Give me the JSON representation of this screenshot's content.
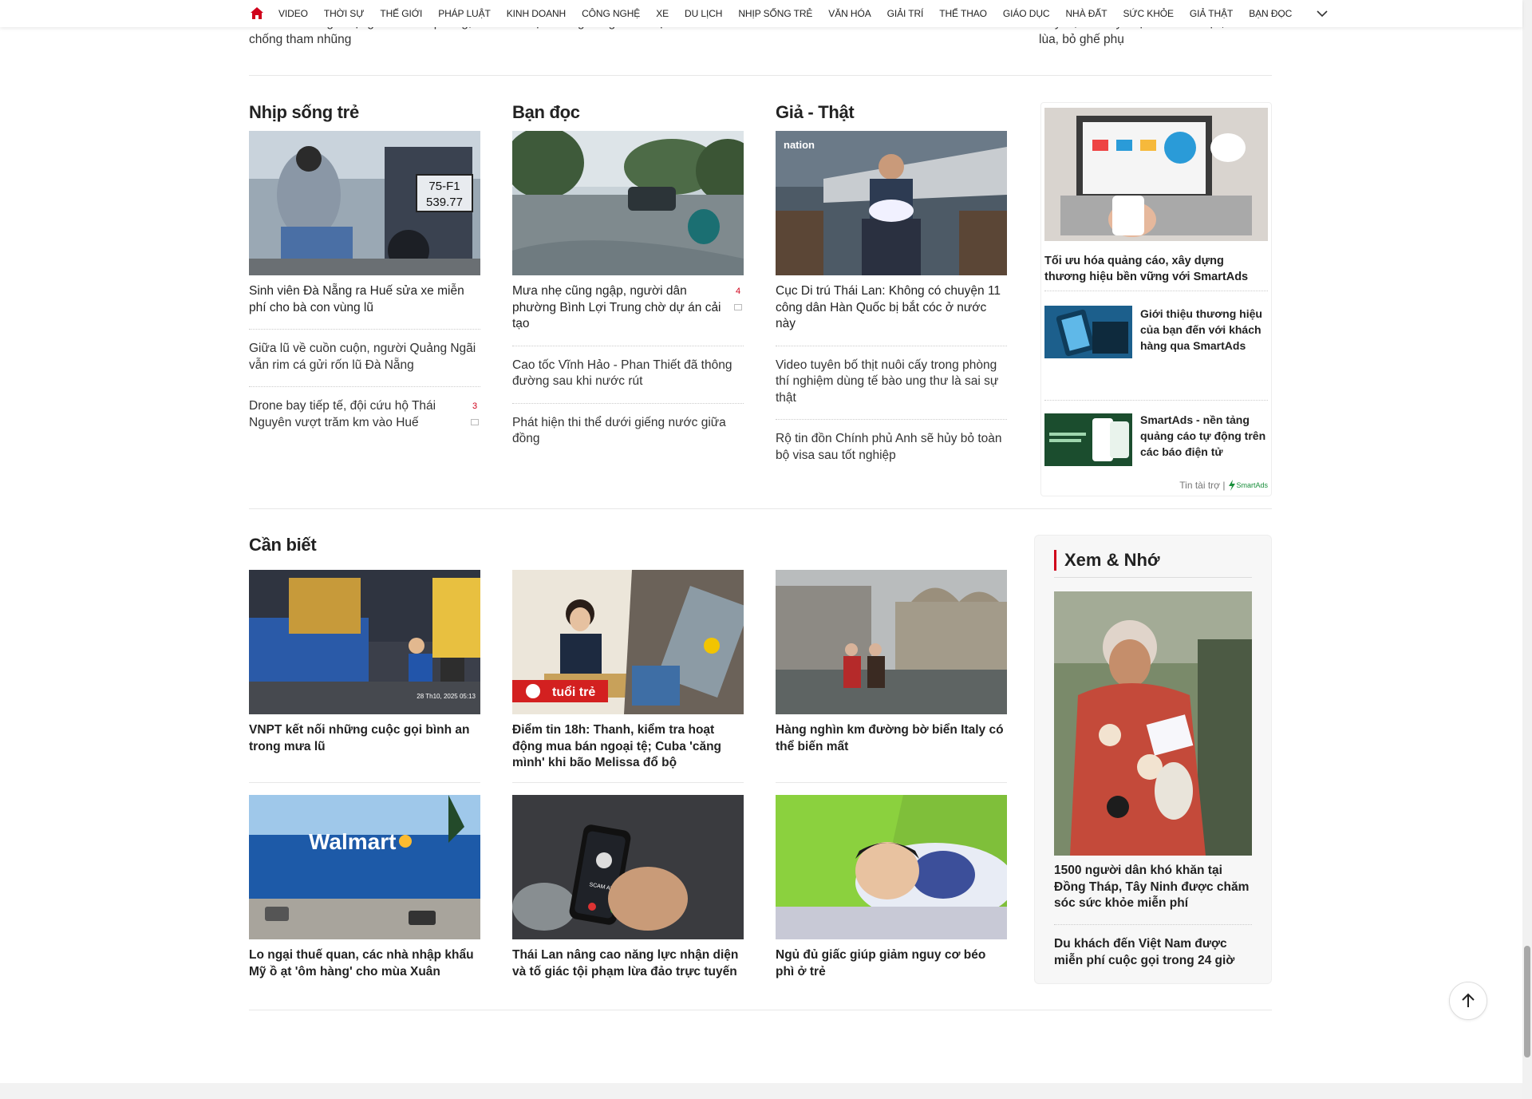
{
  "nav": {
    "items": [
      "VIDEO",
      "THỜI SỰ",
      "THẾ GIỚI",
      "PHÁP LUẬT",
      "KINH DOANH",
      "CÔNG NGHỆ",
      "XE",
      "DU LỊCH",
      "NHỊP SỐNG TRẺ",
      "VĂN HÓA",
      "GIẢI TRÍ",
      "THỂ THAO",
      "GIÁO DỤC",
      "NHÀ ĐẤT",
      "SỨC KHỎE",
      "GIẢ THẬT",
      "BẠN ĐỌC"
    ]
  },
  "prev": {
    "col1": "X cho các tác giả đạt giải báo chí phòng, chống tham nhũng",
    "col2": "ổn định trong thế giới bất định",
    "col4": "Royce, Bentley: Nội thất siêu độc, sức lùa, bỏ ghế phụ"
  },
  "sections": {
    "nhip_song_tre": {
      "title": "Nhịp sống trẻ",
      "lead": "Sinh viên Đà Nẵng ra Huế sửa xe miễn phí cho bà con vùng lũ",
      "plate_line1": "75-F1",
      "plate_line2": "539.77",
      "items": [
        {
          "text": "Giữa lũ về cuồn cuộn, người Quảng Ngãi vẫn rim cá gửi rốn lũ Đà Nẵng",
          "count": ""
        },
        {
          "text": "Drone bay tiếp tế, đội cứu hộ Thái Nguyên vượt trăm km vào Huế",
          "count": "3"
        }
      ]
    },
    "ban_doc": {
      "title": "Bạn đọc",
      "lead": "Mưa nhẹ cũng ngập, người dân phường Bình Lợi Trung chờ dự án cải tạo",
      "lead_count": "4",
      "items": [
        {
          "text": "Cao tốc Vĩnh Hảo - Phan Thiết đã thông đường sau khi nước rút",
          "count": ""
        },
        {
          "text": "Phát hiện thi thể dưới giếng nước giữa đồng",
          "count": ""
        }
      ]
    },
    "gia_that": {
      "title": "Giả - Thật",
      "lead": "Cục Di trú Thái Lan: Không có chuyện 11 công dân Hàn Quốc bị bắt cóc ở nước này",
      "img_logo": "nation",
      "items": [
        {
          "text": "Video tuyên bố thịt nuôi cấy trong phòng thí nghiệm dùng tế bào ung thư là sai sự thật",
          "count": ""
        },
        {
          "text": "Rộ tin đồn Chính phủ Anh sẽ hủy bỏ toàn bộ visa sau tốt nghiệp",
          "count": ""
        }
      ]
    },
    "can_biet": {
      "title": "Cần biết",
      "cards": [
        {
          "title": "VNPT kết nối những cuộc gọi bình an trong mưa lũ",
          "img_caption": "28 Th10, 2025 05:13"
        },
        {
          "title": "Điểm tin 18h: Thanh, kiểm tra hoạt động mua bán ngoại tệ; Cuba 'căng mình' khi bão Melissa đổ bộ",
          "img_caption": "tuổi trẻ"
        },
        {
          "title": "Hàng nghìn km đường bờ biển Italy có thể biến mất",
          "img_caption": ""
        },
        {
          "title": "Lo ngại thuế quan, các nhà nhập khẩu Mỹ ồ ạt 'ôm hàng' cho mùa Xuân",
          "img_caption": "Walmart"
        },
        {
          "title": "Thái Lan nâng cao năng lực nhận diện và tố giác tội phạm lừa đảo trực tuyến",
          "img_caption": "SCAM ALERT"
        },
        {
          "title": "Ngủ đủ giấc giúp giảm nguy cơ béo phì ở trẻ",
          "img_caption": ""
        }
      ]
    }
  },
  "sponsored": {
    "main_title": "Tối ưu hóa quảng cáo, xây dựng thương hiệu bền vững với SmartAds",
    "row1": "Giới thiệu thương hiệu của bạn đến với khách hàng qua SmartAds",
    "row2": "SmartAds - nền tảng quảng cáo tự động trên các báo điện tử",
    "footer_label": "Tin tài trợ |",
    "footer_brand": "SmartAds"
  },
  "xem_nho": {
    "title": "Xem & Nhớ",
    "item1": "1500 người dân khó khăn tại Đồng Tháp, Tây Ninh được chăm sóc sức khỏe miễn phí",
    "item2": "Du khách đến Việt Nam được miễn phí cuộc gọi trong 24 giờ"
  },
  "colors": {
    "accent": "#d0021b",
    "text": "#222222",
    "sponsor_green": "#1a8f3c"
  },
  "icons": [
    "home-icon",
    "chevron-down-icon",
    "comment-icon",
    "arrow-up-icon",
    "smartads-logo-icon"
  ]
}
